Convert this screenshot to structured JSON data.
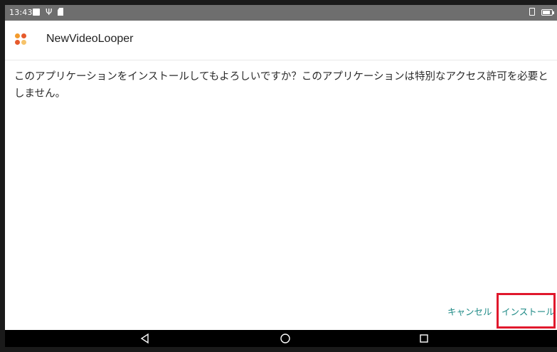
{
  "status_bar": {
    "time": "13:43",
    "icons": [
      "gallery-icon",
      "usb-icon",
      "sd-card-icon",
      "sim-icon",
      "battery-icon"
    ],
    "battery_level_percent": 85
  },
  "app": {
    "name": "NewVideoLooper",
    "icon": "app-icon"
  },
  "dialog": {
    "message": "このアプリケーションをインストールしてもよろしいですか？このアプリケーションは特別なアクセス許可を必要としません。",
    "cancel_label": "キャンセル",
    "install_label": "インストール"
  },
  "nav_bar": {
    "icons": [
      "back-icon",
      "home-icon",
      "recent-apps-icon"
    ]
  },
  "colors": {
    "status_bar": "#6e6e6e",
    "accent": "#1e8a86",
    "highlight": "#e0182c",
    "nav_bar": "#000000"
  }
}
